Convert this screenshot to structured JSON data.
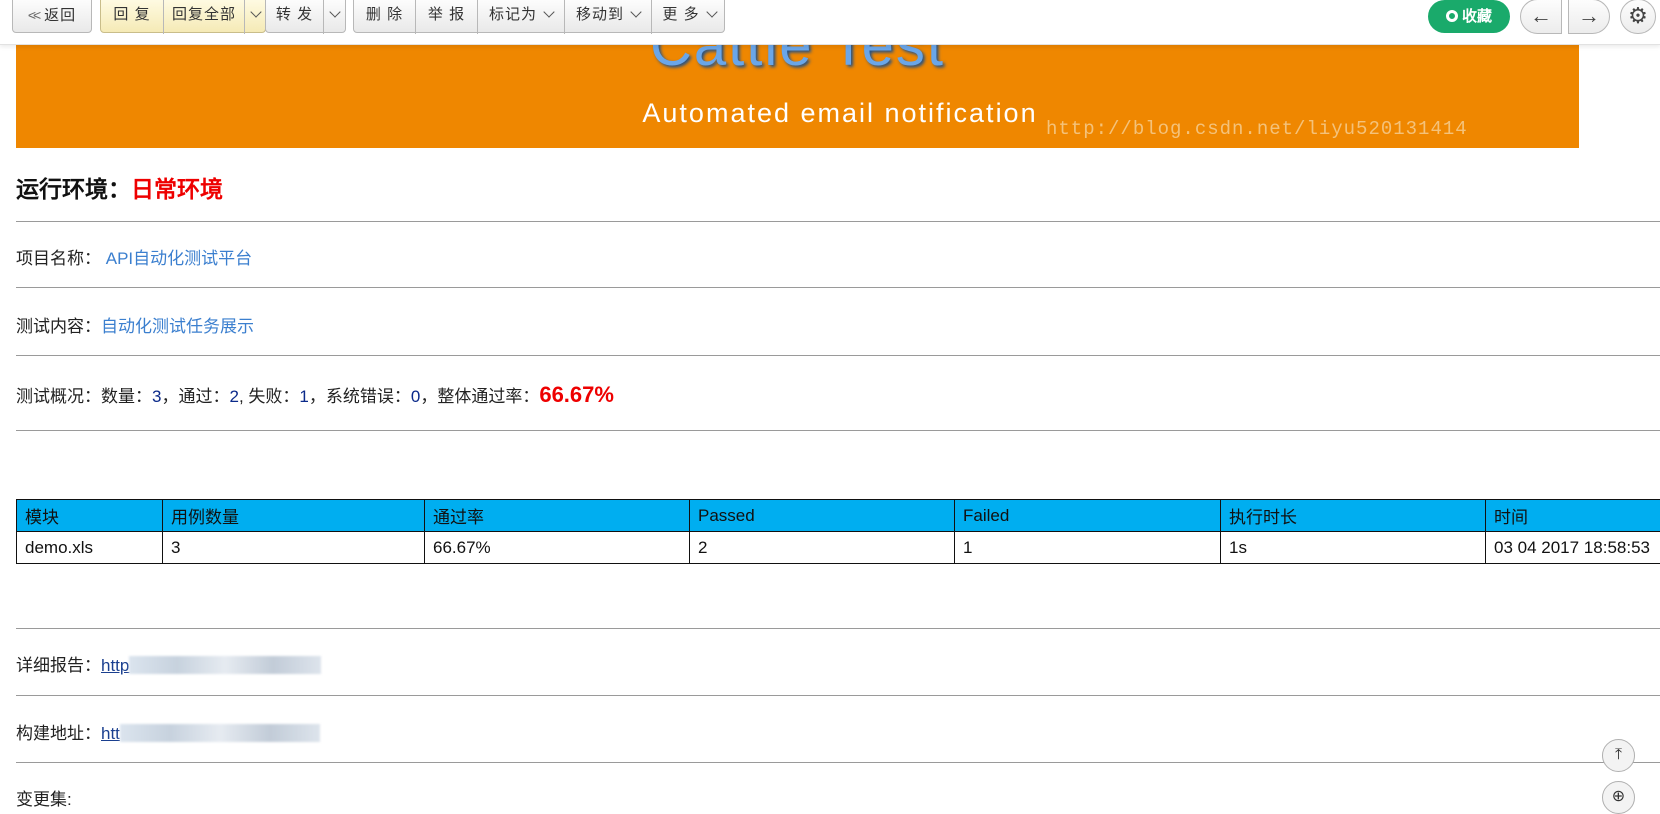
{
  "toolbar": {
    "back": "返回",
    "reply": "回 复",
    "reply_all": "回复全部",
    "forward": "转 发",
    "delete": "删 除",
    "report": "举 报",
    "mark_as": "标记为",
    "move_to": "移动到",
    "more": "更 多",
    "favorite": "收藏",
    "prev_icon": "←",
    "next_icon": "→",
    "settings_icon": "⚙"
  },
  "banner": {
    "title": "Cattle  Test",
    "subtitle": "Automated email notification",
    "watermark": "http://blog.csdn.net/liyu520131414"
  },
  "env": {
    "label": "运行环境：",
    "value": "日常环境"
  },
  "project": {
    "label": "项目名称：",
    "value": "API自动化测试平台"
  },
  "content": {
    "label": "测试内容：",
    "value": "自动化测试任务展示"
  },
  "summary": {
    "prefix": "测试概况：数量：",
    "count": "3",
    "pass_label": "，通过：",
    "pass": "2",
    "fail_label": ", 失败：",
    "fail": "1",
    "error_label": "，系统错误：",
    "error": "0",
    "rate_label": "，整体通过率：",
    "rate": "66.67%"
  },
  "table": {
    "headers": [
      "模块",
      "用例数量",
      "通过率",
      "Passed",
      "Failed",
      "执行时长",
      "时间"
    ],
    "rows": [
      [
        "demo.xls",
        "3",
        "66.67%",
        "2",
        "1",
        "1s",
        "03 04 2017 18:58:53"
      ]
    ]
  },
  "detail_report": {
    "label": "详细报告：",
    "link_text": "http"
  },
  "build_url": {
    "label": "构建地址：",
    "link_text": "htt"
  },
  "changes": {
    "label": "变更集:"
  },
  "colors": {
    "banner": "#ef8700",
    "table_header": "#00aef0",
    "favorite": "#1aaa6b",
    "highlight_red": "#ee0000"
  }
}
